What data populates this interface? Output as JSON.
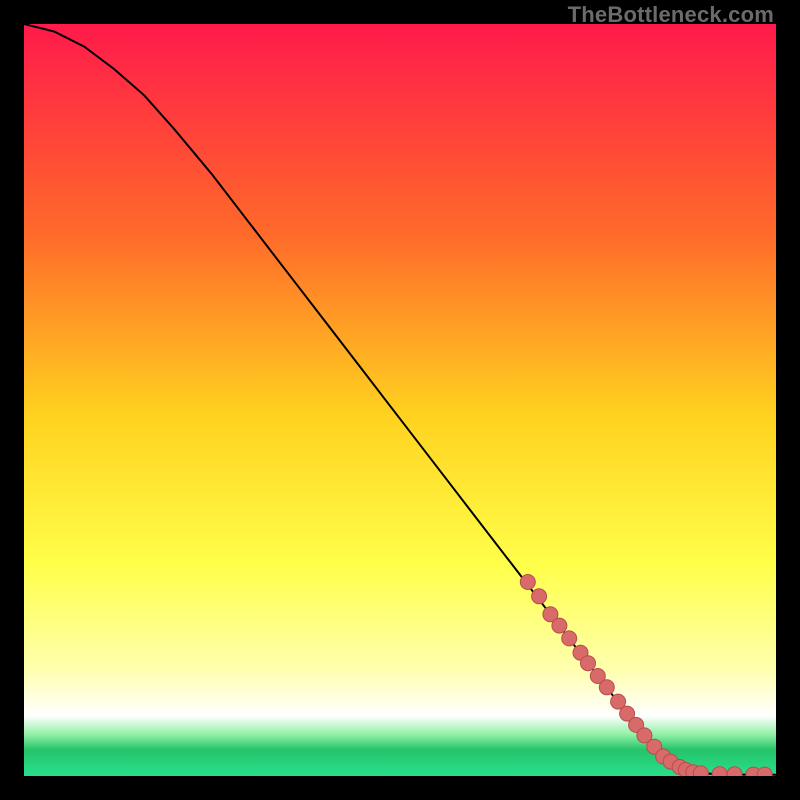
{
  "watermark": "TheBottleneck.com",
  "colors": {
    "gradient_top": "#ff1a4b",
    "gradient_mid1": "#ff6a2a",
    "gradient_mid2": "#ffd21f",
    "gradient_mid3": "#ffff4a",
    "gradient_mid4": "#ffffb0",
    "gradient_bottom_white": "#ffffff",
    "gradient_green1": "#8ff0a4",
    "gradient_green2": "#26c36a",
    "gradient_green3": "#28e08c",
    "curve": "#000000",
    "marker_fill": "#d86a6a",
    "marker_stroke": "#b84c4c"
  },
  "chart_data": {
    "type": "line",
    "title": "",
    "xlabel": "",
    "ylabel": "",
    "xlim": [
      0,
      100
    ],
    "ylim": [
      0,
      100
    ],
    "series": [
      {
        "name": "bottleneck-curve",
        "x": [
          0,
          4,
          8,
          12,
          16,
          20,
          25,
          30,
          35,
          40,
          45,
          50,
          55,
          60,
          65,
          70,
          75,
          80,
          83,
          86,
          88,
          90,
          92,
          94,
          96,
          98,
          100
        ],
        "y": [
          100,
          99,
          97,
          94,
          90.5,
          86,
          80,
          73.5,
          67,
          60.5,
          54,
          47.5,
          41,
          34.5,
          28,
          21.5,
          15,
          8.5,
          4.8,
          2.0,
          0.9,
          0.4,
          0.25,
          0.2,
          0.18,
          0.17,
          0.17
        ]
      }
    ],
    "markers": {
      "name": "highlighted-segment",
      "x": [
        67,
        68.5,
        70,
        71.2,
        72.5,
        74,
        75,
        76.3,
        77.5,
        79,
        80.2,
        81.4,
        82.5,
        83.8,
        85,
        86,
        87.2,
        88,
        89,
        90,
        92.5,
        94.5,
        97,
        98.5
      ],
      "y": [
        25.8,
        23.9,
        21.5,
        20.0,
        18.3,
        16.4,
        15.0,
        13.3,
        11.8,
        9.9,
        8.3,
        6.8,
        5.4,
        3.9,
        2.6,
        1.9,
        1.2,
        0.8,
        0.5,
        0.35,
        0.25,
        0.22,
        0.19,
        0.18
      ]
    }
  }
}
